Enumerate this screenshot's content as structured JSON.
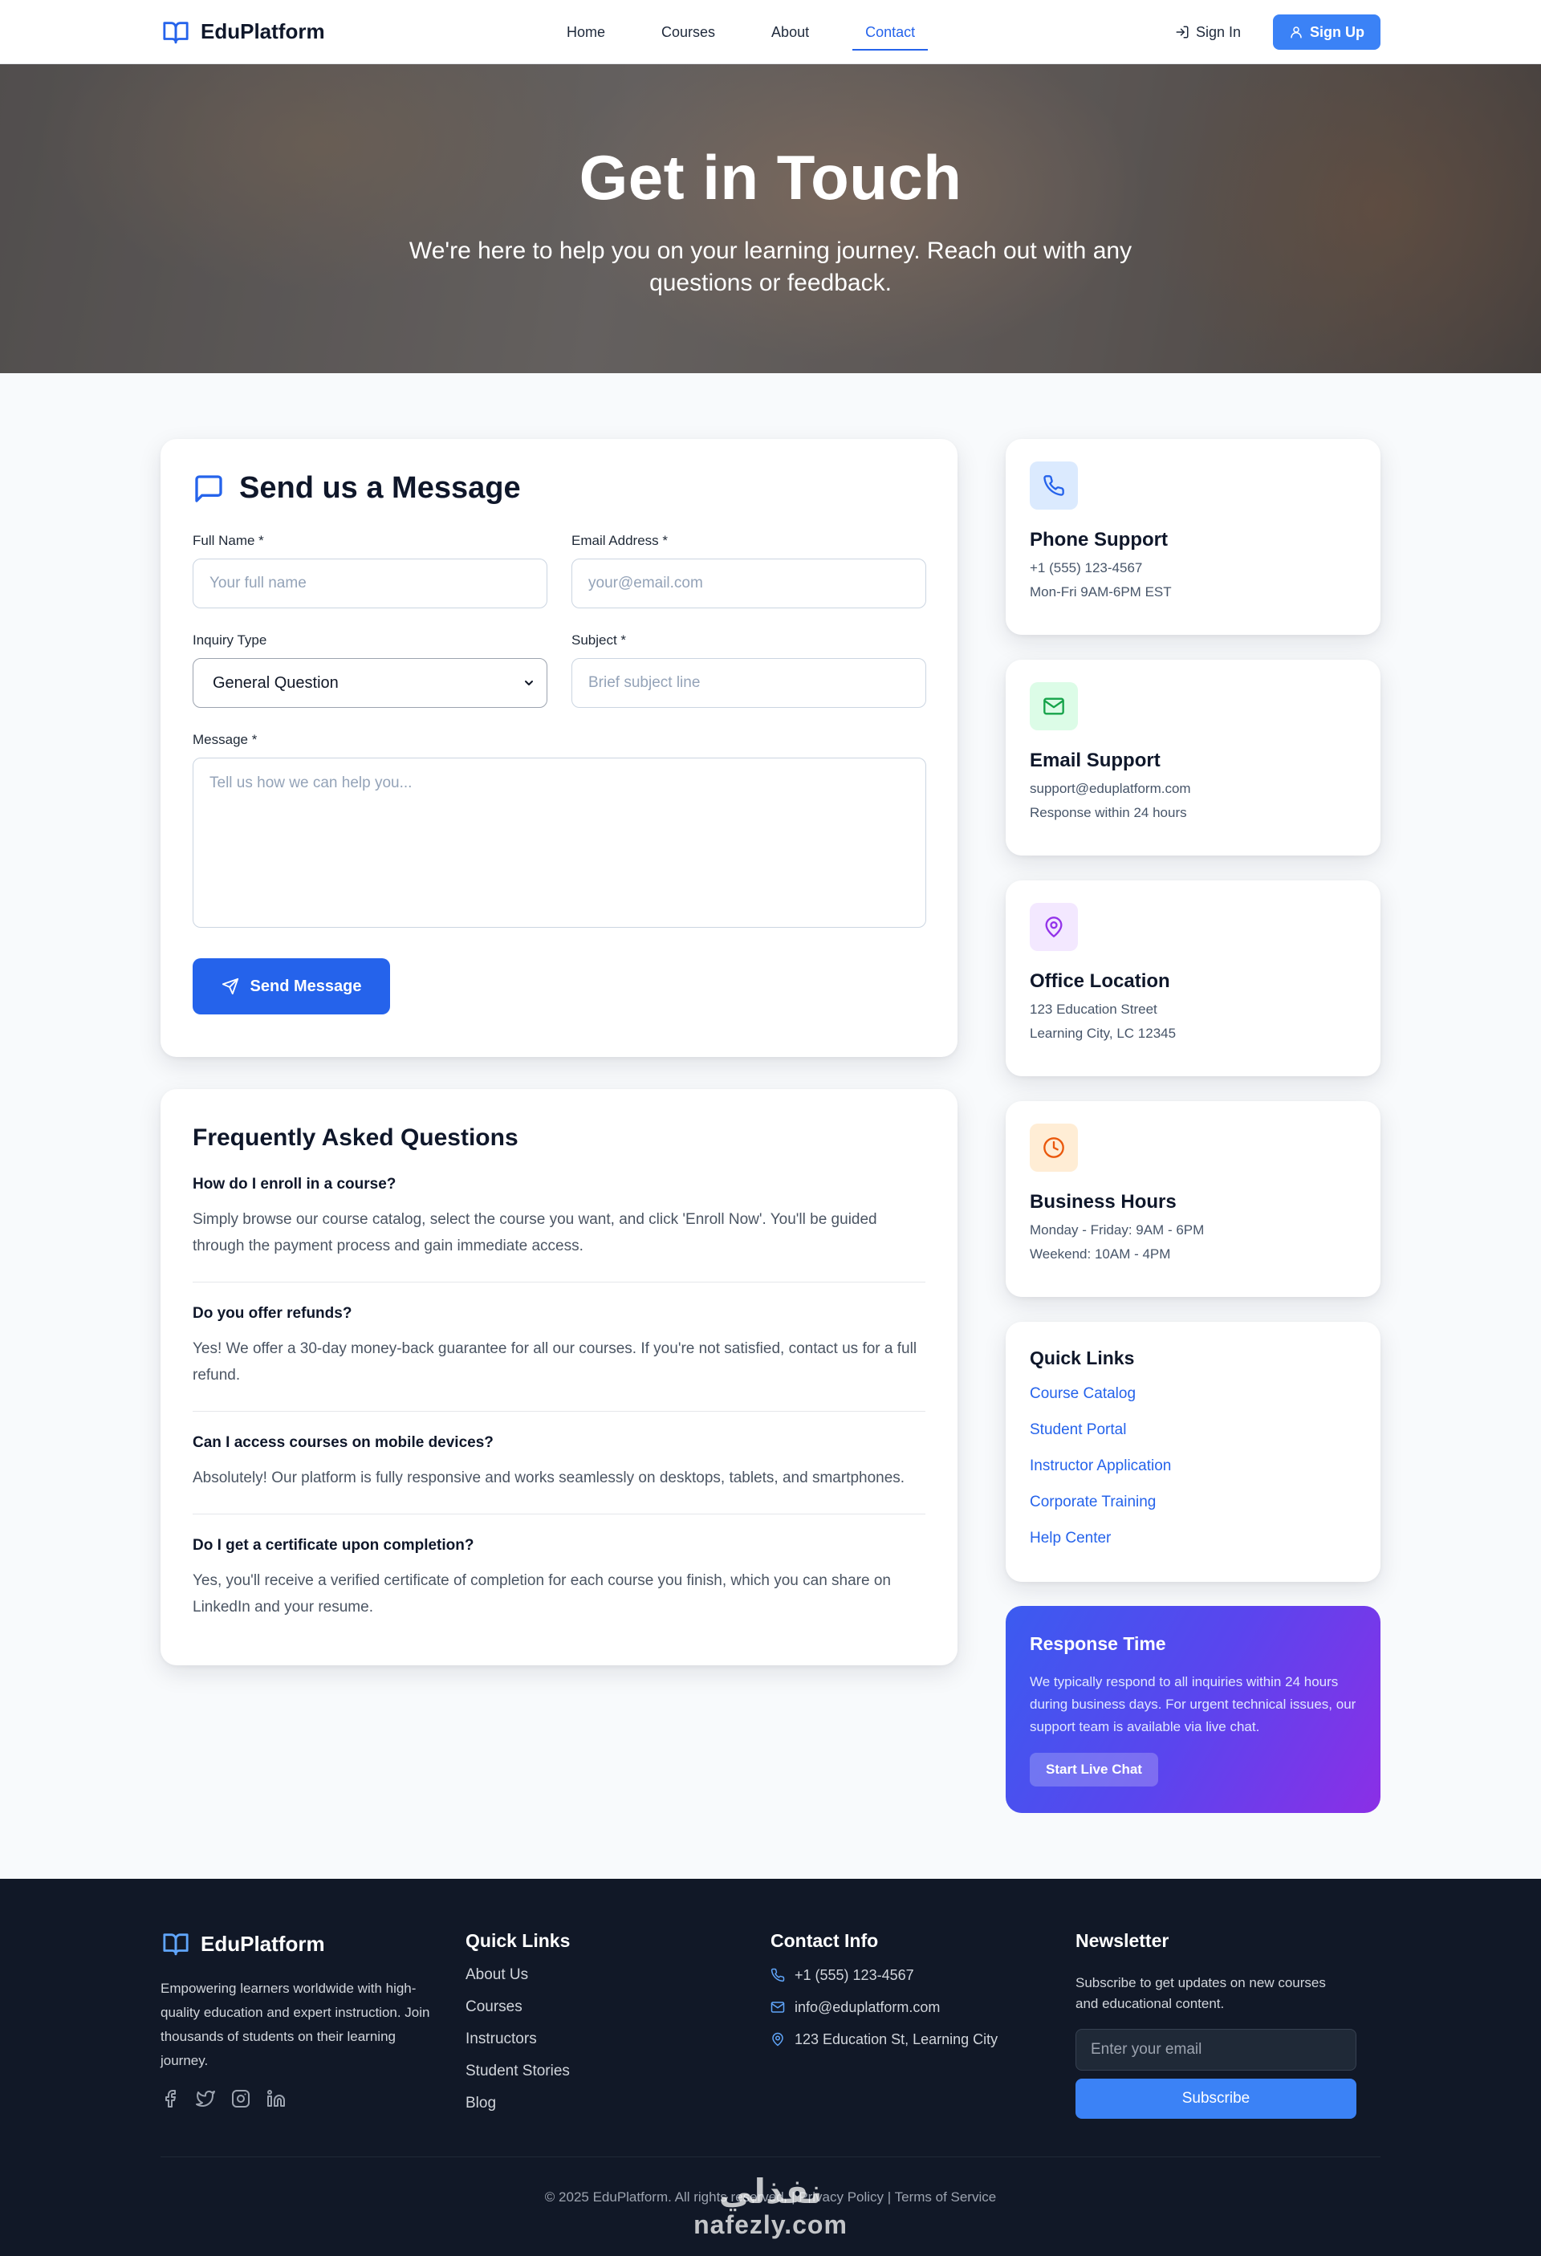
{
  "nav": {
    "brand": "EduPlatform",
    "links": [
      {
        "label": "Home",
        "active": false
      },
      {
        "label": "Courses",
        "active": false
      },
      {
        "label": "About",
        "active": false
      },
      {
        "label": "Contact",
        "active": true
      }
    ],
    "signin": "Sign In",
    "signup": "Sign Up"
  },
  "hero": {
    "title": "Get in Touch",
    "subtitle": "We're here to help you on your learning journey. Reach out with any questions or feedback."
  },
  "form": {
    "title": "Send us a Message",
    "fullname_label": "Full Name *",
    "fullname_placeholder": "Your full name",
    "email_label": "Email Address *",
    "email_placeholder": "your@email.com",
    "inquiry_label": "Inquiry Type",
    "inquiry_value": "General Question",
    "subject_label": "Subject *",
    "subject_placeholder": "Brief subject line",
    "message_label": "Message *",
    "message_placeholder": "Tell us how we can help you...",
    "send_label": "Send Message"
  },
  "faq": {
    "title": "Frequently Asked Questions",
    "items": [
      {
        "q": "How do I enroll in a course?",
        "a": "Simply browse our course catalog, select the course you want, and click 'Enroll Now'. You'll be guided through the payment process and gain immediate access."
      },
      {
        "q": "Do you offer refunds?",
        "a": "Yes! We offer a 30-day money-back guarantee for all our courses. If you're not satisfied, contact us for a full refund."
      },
      {
        "q": "Can I access courses on mobile devices?",
        "a": "Absolutely! Our platform is fully responsive and works seamlessly on desktops, tablets, and smartphones."
      },
      {
        "q": "Do I get a certificate upon completion?",
        "a": "Yes, you'll receive a verified certificate of completion for each course you finish, which you can share on LinkedIn and your resume."
      }
    ]
  },
  "info": {
    "phone": {
      "title": "Phone Support",
      "line1": "+1 (555) 123-4567",
      "line2": "Mon-Fri 9AM-6PM EST",
      "icon": "phone-icon",
      "color": "#2563eb",
      "bg": "#dbeafe"
    },
    "email": {
      "title": "Email Support",
      "line1": "support@eduplatform.com",
      "line2": "Response within 24 hours",
      "icon": "mail-icon",
      "color": "#16a34a",
      "bg": "#dcfce7"
    },
    "office": {
      "title": "Office Location",
      "line1": "123 Education Street",
      "line2": "Learning City, LC 12345",
      "icon": "map-pin-icon",
      "color": "#9333ea",
      "bg": "#f3e8ff"
    },
    "hours": {
      "title": "Business Hours",
      "line1": "Monday - Friday: 9AM - 6PM",
      "line2": "Weekend: 10AM - 4PM",
      "icon": "clock-icon",
      "color": "#ea580c",
      "bg": "#ffedd5"
    }
  },
  "quick_links": {
    "title": "Quick Links",
    "items": [
      "Course Catalog",
      "Student Portal",
      "Instructor Application",
      "Corporate Training",
      "Help Center"
    ]
  },
  "response": {
    "title": "Response Time",
    "text": "We typically respond to all inquiries within 24 hours during business days. For urgent technical issues, our support team is available via live chat.",
    "button": "Start Live Chat"
  },
  "footer": {
    "brand": "EduPlatform",
    "desc": "Empowering learners worldwide with high-quality education and expert instruction. Join thousands of students on their learning journey.",
    "quick_title": "Quick Links",
    "quick_links": [
      "About Us",
      "Courses",
      "Instructors",
      "Student Stories",
      "Blog"
    ],
    "contact_title": "Contact Info",
    "contact_phone": "+1 (555) 123-4567",
    "contact_email": "info@eduplatform.com",
    "contact_address": "123 Education St, Learning City",
    "news_title": "Newsletter",
    "news_text": "Subscribe to get updates on new courses and educational content.",
    "news_placeholder": "Enter your email",
    "news_button": "Subscribe",
    "copyright": "© 2025 EduPlatform. All rights reserved. | Privacy Policy | Terms of Service"
  },
  "watermark": {
    "arabic": "نفذلي",
    "latin": "nafezly.com"
  }
}
